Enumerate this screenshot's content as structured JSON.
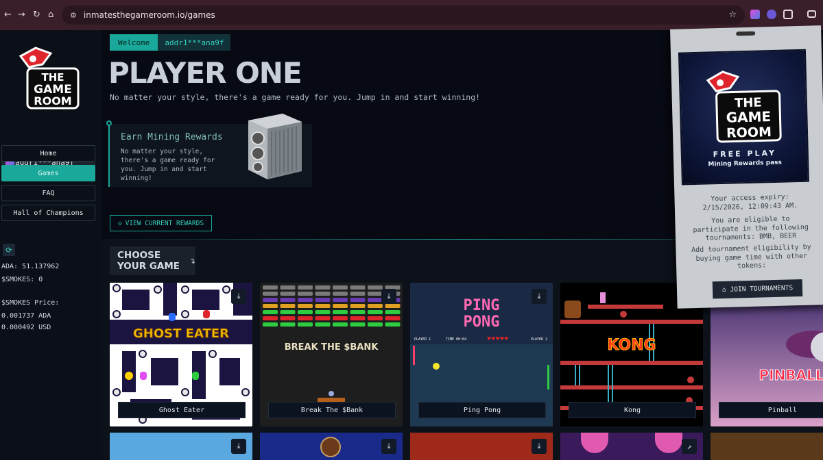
{
  "browser": {
    "url": "inmatesthegameroom.io/games"
  },
  "sidebar": {
    "logo_line1": "THE",
    "logo_line2": "GAME",
    "logo_line3": "ROOM",
    "wallet": "addr1***ana9f",
    "nav": [
      {
        "label": "Home",
        "active": false
      },
      {
        "label": "Games",
        "active": true
      },
      {
        "label": "FAQ",
        "active": false
      },
      {
        "label": "Hall of Champions",
        "active": false
      }
    ],
    "ada_label": "ADA:",
    "ada_value": "51.137962",
    "smokes_label": "$SMOKES:",
    "smokes_value": "0",
    "price_label": "$SMOKES Price:",
    "price_ada": "0.001737 ADA",
    "price_usd": "0.000492 USD"
  },
  "hero": {
    "welcome": "Welcome",
    "wallet": "addr1***ana9f",
    "title": "PLAYER ONE",
    "subtitle": "No matter your style, there's a game ready for you. Jump in and start winning!",
    "mining_title": "Earn Mining Rewards",
    "mining_text": "No matter your style, there's a game ready for you. Jump in and start winning!",
    "rewards_button": "VIEW CURRENT REWARDS"
  },
  "games_section": {
    "heading": "CHOOSE YOUR GAME",
    "games": [
      {
        "name": "Ghost Eater",
        "art_title": "GHOST EATER"
      },
      {
        "name": "Break The $Bank",
        "art_title": "BREAK THE $BANK"
      },
      {
        "name": "Ping Pong",
        "art_title_1": "PING",
        "art_title_2": "PONG",
        "hud_left": "PLAYER 1",
        "hud_time": "TIME 00:04",
        "hud_right": "PLAYER 2"
      },
      {
        "name": "Kong",
        "art_title": "KONG"
      },
      {
        "name": "Pinball",
        "art_title": "PINBALL"
      }
    ]
  },
  "pass": {
    "logo_line1": "THE",
    "logo_line2": "GAME",
    "logo_line3": "ROOM",
    "free_play": "FREE PLAY",
    "pass_name": "Mining Rewards pass",
    "expiry_label": "Your access expiry:",
    "expiry_value": "2/15/2026, 12:09:43 AM.",
    "eligible_text": "You are eligible to participate in the following tournaments: BMB, BEER",
    "add_text": "Add tournament eligibility by buying game time with other tokens:",
    "join_button": "JOIN TOURNAMENTS"
  },
  "colors": {
    "accent": "#1aa89a",
    "background": "#0c111a",
    "browser_bar": "#3a1f2a"
  }
}
